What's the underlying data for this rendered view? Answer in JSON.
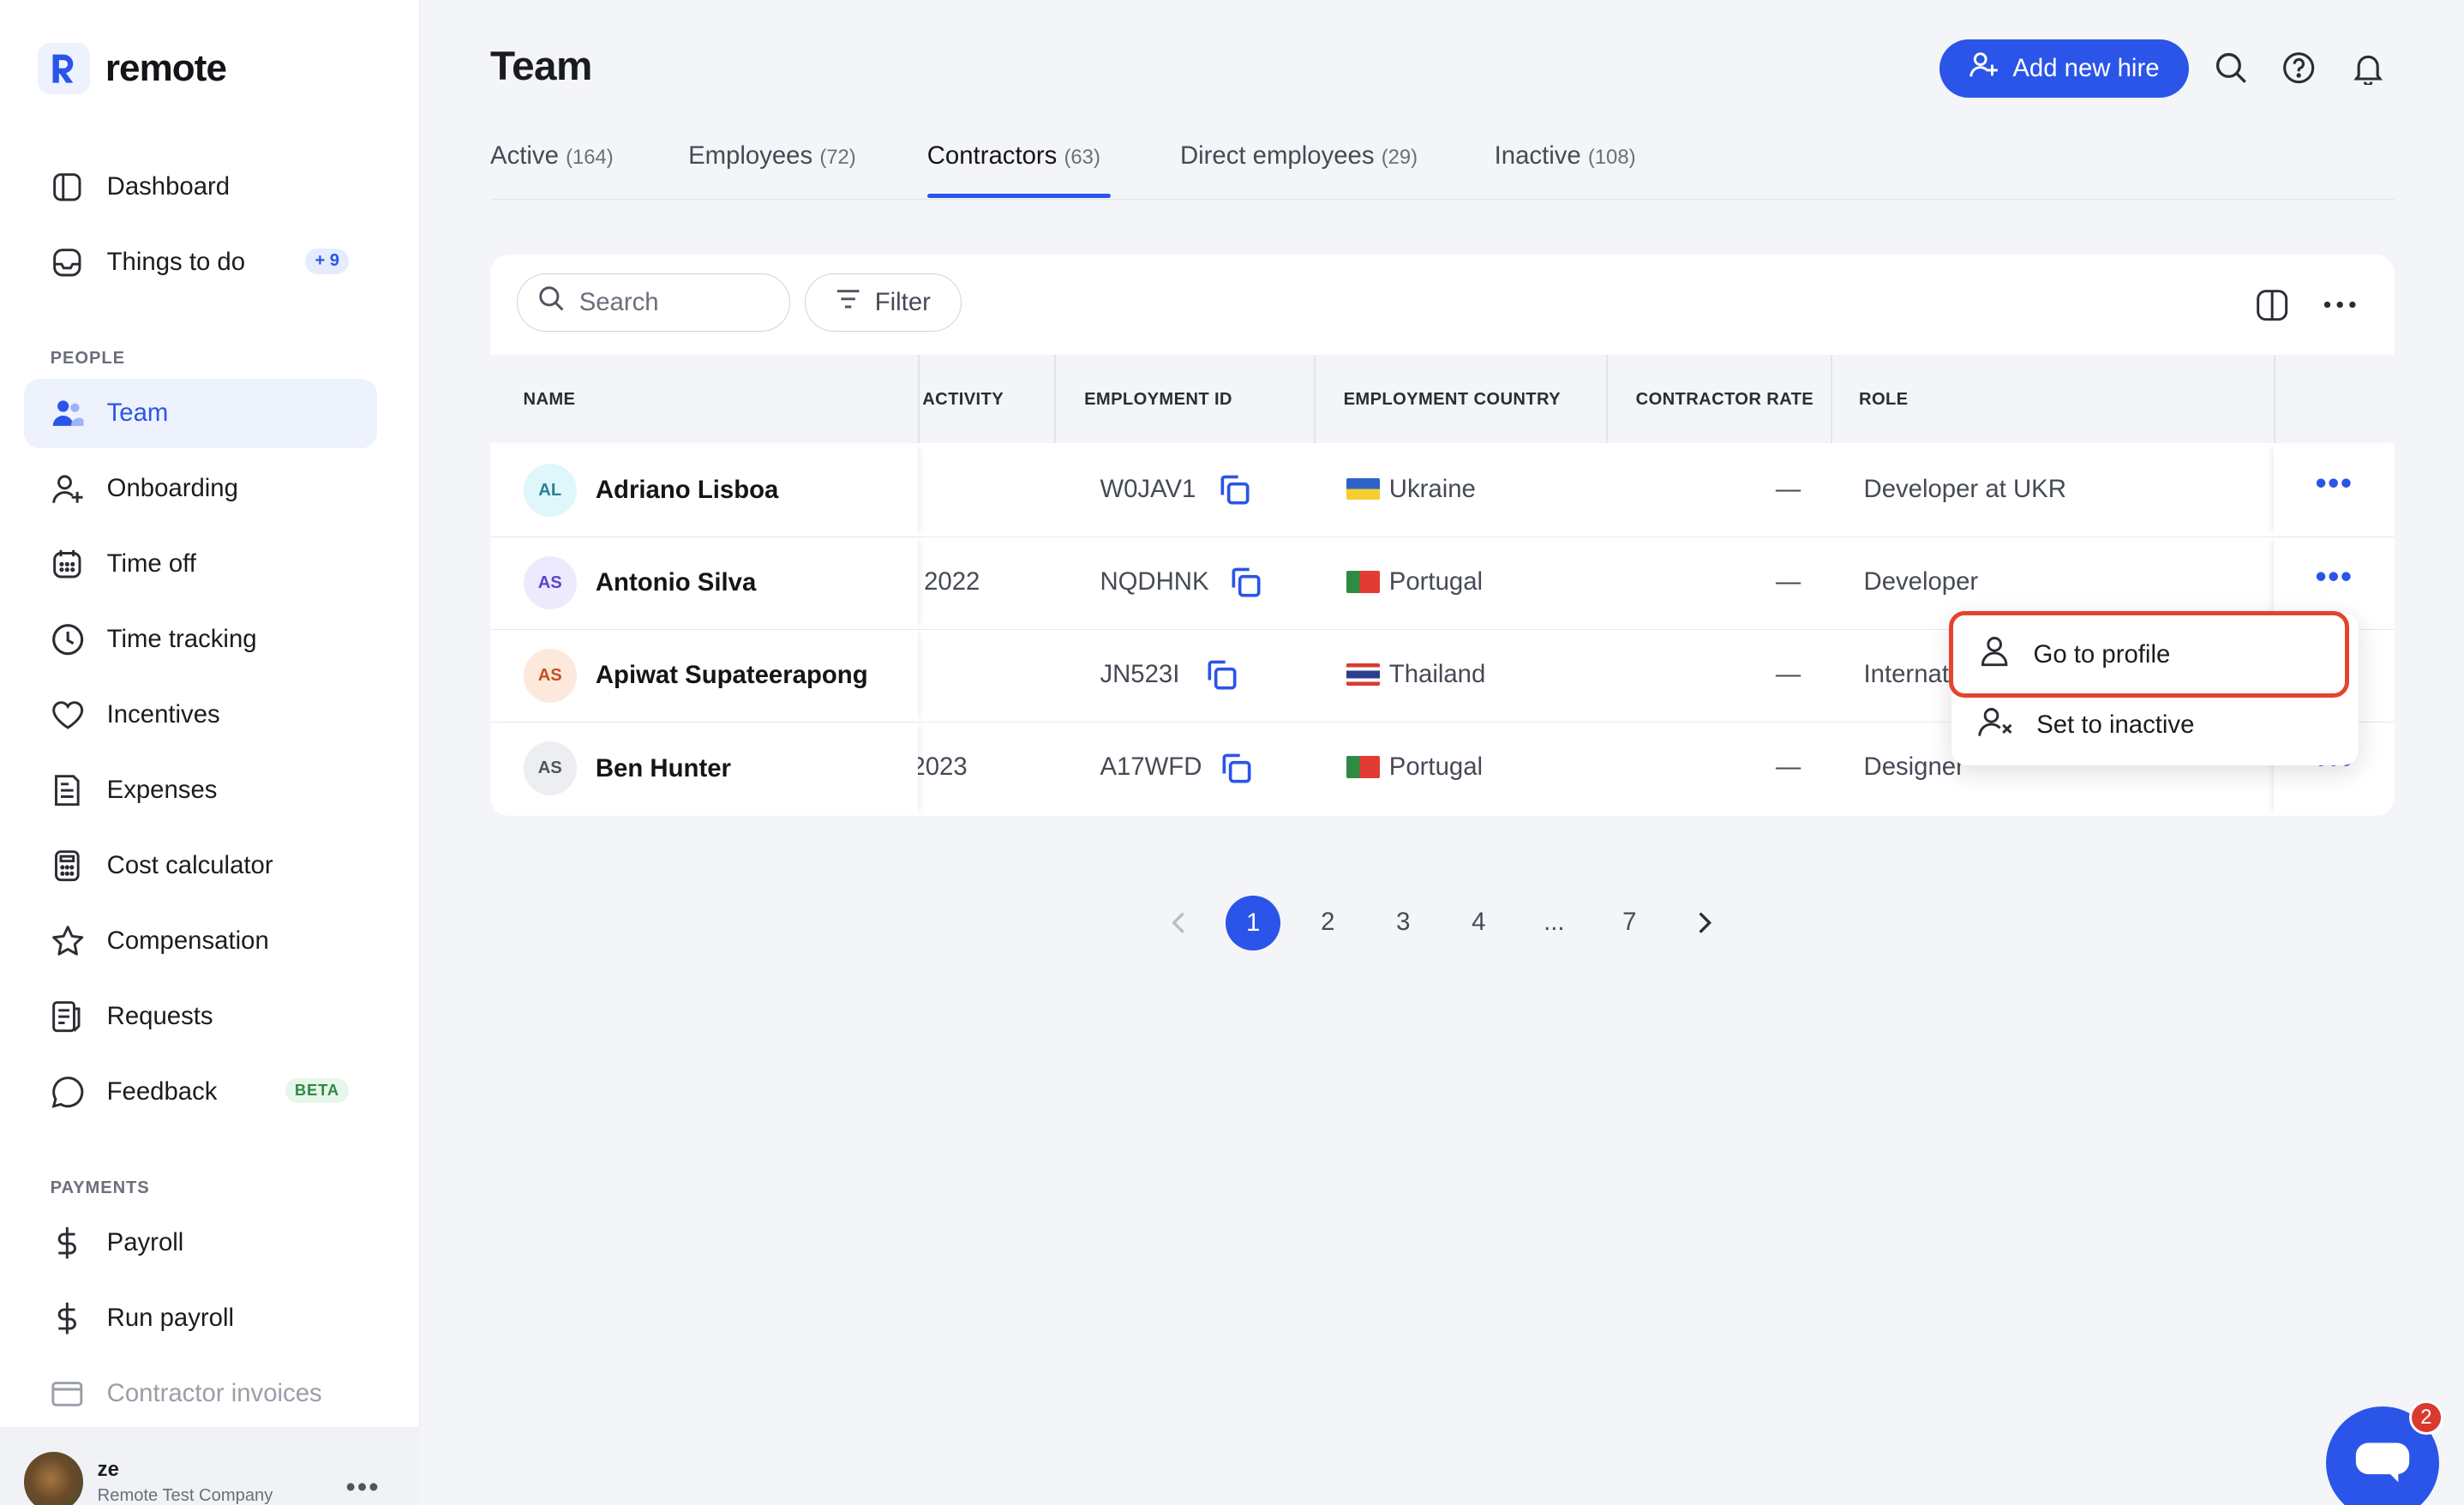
{
  "brand": {
    "name": "remote"
  },
  "sidebar": {
    "items": [
      {
        "label": "Dashboard",
        "icon": "dashboard-icon"
      },
      {
        "label": "Things to do",
        "icon": "inbox-icon",
        "badge": "+ 9"
      }
    ],
    "sections": [
      {
        "title": "PEOPLE",
        "items": [
          {
            "label": "Team",
            "icon": "team-icon",
            "active": true
          },
          {
            "label": "Onboarding",
            "icon": "user-plus-icon"
          },
          {
            "label": "Time off",
            "icon": "calendar-icon"
          },
          {
            "label": "Time tracking",
            "icon": "clock-icon"
          },
          {
            "label": "Incentives",
            "icon": "heart-icon"
          },
          {
            "label": "Expenses",
            "icon": "receipt-icon"
          },
          {
            "label": "Cost calculator",
            "icon": "calculator-icon"
          },
          {
            "label": "Compensation",
            "icon": "star-icon"
          },
          {
            "label": "Requests",
            "icon": "requests-icon"
          },
          {
            "label": "Feedback",
            "icon": "chat-bubble-icon",
            "badge": "BETA"
          }
        ]
      },
      {
        "title": "PAYMENTS",
        "items": [
          {
            "label": "Payroll",
            "icon": "dollar-icon"
          },
          {
            "label": "Run payroll",
            "icon": "dollar-icon"
          },
          {
            "label": "Contractor invoices",
            "icon": "invoice-icon"
          }
        ]
      }
    ],
    "user": {
      "name": "ze",
      "company": "Remote Test Company"
    }
  },
  "header": {
    "title": "Team",
    "add_button": "Add new hire"
  },
  "tabs": [
    {
      "label": "Active",
      "count": "(164)"
    },
    {
      "label": "Employees",
      "count": "(72)"
    },
    {
      "label": "Contractors",
      "count": "(63)",
      "active": true
    },
    {
      "label": "Direct employees",
      "count": "(29)"
    },
    {
      "label": "Inactive",
      "count": "(108)"
    }
  ],
  "toolbar": {
    "search_placeholder": "Search",
    "filter_label": "Filter"
  },
  "table": {
    "columns": [
      "NAME",
      "ACTIVITY",
      "EMPLOYMENT ID",
      "EMPLOYMENT COUNTRY",
      "CONTRACTOR RATE",
      "ROLE"
    ],
    "rows": [
      {
        "initials": "AL",
        "name": "Adriano Lisboa",
        "activity": "",
        "employment_id": "W0JAV1",
        "country": "Ukraine",
        "rate": "—",
        "role": "Developer at UKR"
      },
      {
        "initials": "AS",
        "name": "Antonio Silva",
        "activity": "2022",
        "employment_id": "NQDHNK",
        "country": "Portugal",
        "rate": "—",
        "role": "Developer"
      },
      {
        "initials": "AS",
        "name": "Apiwat Supateerapong",
        "activity": "",
        "employment_id": "JN523I",
        "country": "Thailand",
        "rate": "—",
        "role": "Internat"
      },
      {
        "initials": "AS",
        "name": "Ben Hunter",
        "activity": "2023",
        "employment_id": "A17WFD",
        "country": "Portugal",
        "rate": "—",
        "role": "Designer"
      }
    ]
  },
  "row_menu": {
    "items": [
      "Go to profile",
      "Set to inactive"
    ]
  },
  "pagination": {
    "pages": [
      "1",
      "2",
      "3",
      "4",
      "...",
      "7"
    ],
    "current": "1"
  },
  "chat": {
    "unread": "2"
  },
  "colors": {
    "accent": "#2a55e8",
    "highlight": "#e4432f",
    "beta": "#2e8b44"
  }
}
